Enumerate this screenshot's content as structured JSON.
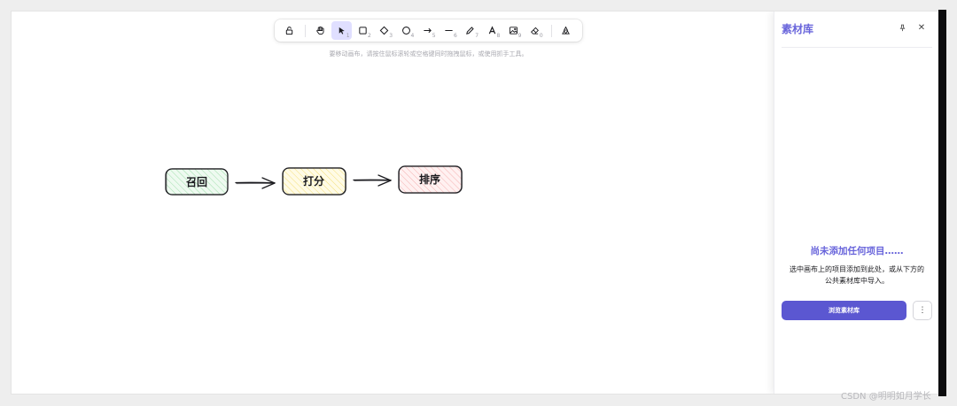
{
  "toolbar": {
    "tools": [
      {
        "icon": "lock-icon",
        "num": ""
      },
      {
        "icon": "hand-icon",
        "num": ""
      },
      {
        "icon": "selection-icon",
        "num": "1",
        "active": true
      },
      {
        "icon": "rectangle-icon",
        "num": "2"
      },
      {
        "icon": "diamond-icon",
        "num": "3"
      },
      {
        "icon": "ellipse-icon",
        "num": "4"
      },
      {
        "icon": "arrow-icon",
        "num": "5"
      },
      {
        "icon": "line-icon",
        "num": "6"
      },
      {
        "icon": "pencil-icon",
        "num": "7"
      },
      {
        "icon": "text-icon",
        "num": "8"
      },
      {
        "icon": "image-icon",
        "num": "9"
      },
      {
        "icon": "eraser-icon",
        "num": "0"
      },
      {
        "icon": "library-icon",
        "num": ""
      }
    ],
    "hint": "要移动画布，请按住鼠标滚轮或空格键同时拖拽鼠标，或使用抓手工具。"
  },
  "canvas": {
    "nodes": [
      {
        "label": "召回",
        "fill": "#c8f0cf"
      },
      {
        "label": "打分",
        "fill": "#fff3b8"
      },
      {
        "label": "排序",
        "fill": "#ffd6d6"
      }
    ],
    "stroke": "#1b1b1f"
  },
  "library": {
    "title": "素材库",
    "pin": "⊥",
    "close": "✕",
    "empty_title": "尚未添加任何项目……",
    "empty_desc_line1": "选中画布上的项目添加到此处，或从下方的",
    "empty_desc_line2": "公共素材库中导入。",
    "browse_button": "浏览素材库",
    "more_button": "⋮",
    "accent": "#6965db"
  },
  "watermark": "CSDN @明明如月学长"
}
